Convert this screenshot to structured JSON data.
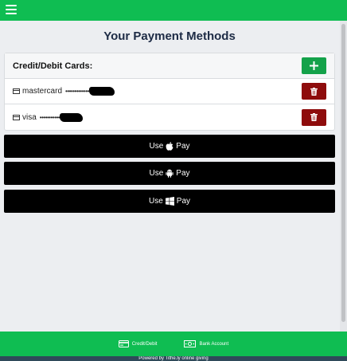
{
  "header": {
    "menu_icon": "hamburger-icon",
    "accent_color": "#0fbd52"
  },
  "page": {
    "title": "Your Payment Methods"
  },
  "cards_panel": {
    "title": "Credit/Debit Cards:",
    "add_icon": "plus-icon",
    "cards": [
      {
        "brand": "mastercard",
        "masked_number": "•••••••••••••",
        "delete_icon": "trash-icon"
      },
      {
        "brand": "visa",
        "masked_number": "•••••••••••",
        "delete_icon": "trash-icon"
      }
    ]
  },
  "pay_buttons": [
    {
      "prefix": "Use",
      "icon": "apple-icon",
      "suffix": "Pay"
    },
    {
      "prefix": "Use",
      "icon": "android-icon",
      "suffix": "Pay"
    },
    {
      "prefix": "Use",
      "icon": "windows-icon",
      "suffix": "Pay"
    }
  ],
  "footer": {
    "tabs": [
      {
        "label": "Credit/Debit",
        "icon": "credit-card-icon"
      },
      {
        "label": "Bank Account",
        "icon": "bank-note-icon"
      }
    ],
    "powered_by": "Powered by Tithe.ly online giving"
  },
  "colors": {
    "add_button": "#14a24a",
    "delete_button": "#8e0c0c",
    "title_text": "#1d2b45",
    "footer_strip": "#2f4a5a"
  }
}
